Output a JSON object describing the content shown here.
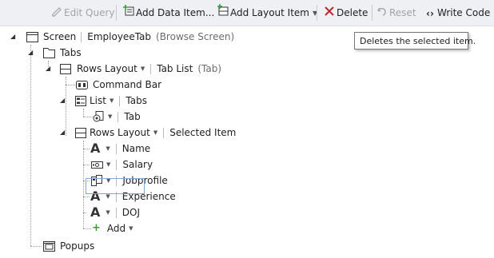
{
  "toolbar": {
    "edit_query": "Edit Query",
    "add_data_item": "Add Data Item...",
    "add_layout_item": "Add Layout Item",
    "delete": "Delete",
    "reset": "Reset",
    "write_code": "Write Code"
  },
  "tooltip": {
    "text": "Deletes the selected item."
  },
  "tree": {
    "screen": {
      "label": "Screen",
      "name": "EmployeeTab",
      "kind": "(Browse Screen)"
    },
    "tabs": "Tabs",
    "rows_layout_1": {
      "label": "Rows Layout",
      "name": "Tab List",
      "kind": "(Tab)"
    },
    "command_bar": "Command Bar",
    "list": {
      "label": "List",
      "name": "Tabs"
    },
    "tab": "Tab",
    "rows_layout_2": {
      "label": "Rows Layout",
      "name": "Selected Item"
    },
    "fields": [
      {
        "name": "Name",
        "icon": "text-icon"
      },
      {
        "name": "Salary",
        "icon": "money-icon"
      },
      {
        "name": "Jobprofile",
        "icon": "phone-icon"
      },
      {
        "name": "Experience",
        "icon": "text-icon"
      },
      {
        "name": "DOJ",
        "icon": "text-icon"
      }
    ],
    "add": "Add",
    "popups": "Popups"
  }
}
